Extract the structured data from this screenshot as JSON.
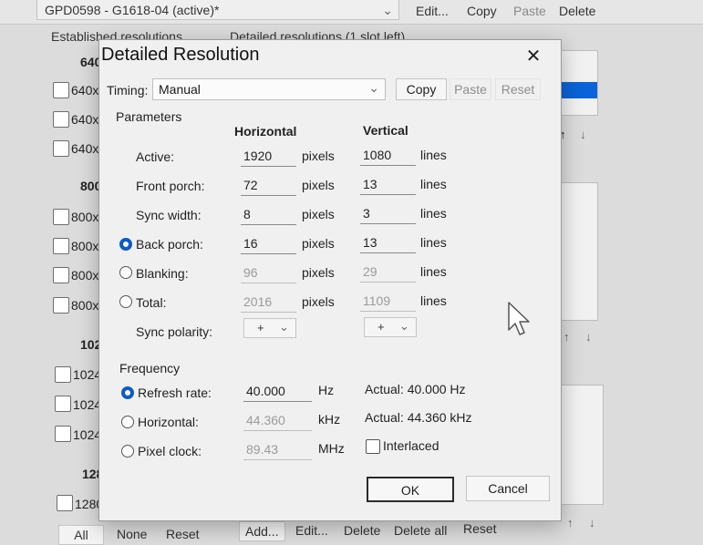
{
  "background": {
    "combo_value": "GPD0598 - G1618-04 (active)*",
    "top_buttons": {
      "edit": "Edit...",
      "copy": "Copy",
      "paste": "Paste",
      "delete": "Delete"
    },
    "tabs": {
      "established": "Established resolutions",
      "detailed": "Detailed resolutions (1 slot left)"
    },
    "groups": [
      {
        "header": "640",
        "rows": [
          "640x",
          "640x",
          "640x"
        ]
      },
      {
        "header": "800",
        "rows": [
          "800x",
          "800x",
          "800x",
          "800x"
        ]
      },
      {
        "header": "102",
        "rows": [
          "1024",
          "1024",
          "1024"
        ]
      },
      {
        "header": "128",
        "rows": [
          "1280"
        ]
      }
    ],
    "bottom_left": {
      "all": "All",
      "none": "None",
      "reset": "Reset"
    },
    "bottom_right": {
      "add": "Add...",
      "edit": "Edit...",
      "delete": "Delete",
      "delete_all": "Delete all",
      "reset": "Reset"
    },
    "arrows": {
      "up": "↑",
      "down": "↓"
    }
  },
  "dialog": {
    "title": "Detailed Resolution",
    "close": "✕",
    "timing_label": "Timing:",
    "timing_value": "Manual",
    "timing_buttons": {
      "copy": "Copy",
      "paste": "Paste",
      "reset": "Reset"
    },
    "parameters_label": "Parameters",
    "col_horizontal": "Horizontal",
    "col_vertical": "Vertical",
    "rows": [
      {
        "label": "Active:",
        "h": "1920",
        "h_unit": "pixels",
        "v": "1080",
        "v_unit": "lines"
      },
      {
        "label": "Front porch:",
        "h": "72",
        "h_unit": "pixels",
        "v": "13",
        "v_unit": "lines"
      },
      {
        "label": "Sync width:",
        "h": "8",
        "h_unit": "pixels",
        "v": "3",
        "v_unit": "lines"
      },
      {
        "label": "Back porch:",
        "h": "16",
        "h_unit": "pixels",
        "v": "13",
        "v_unit": "lines"
      },
      {
        "label": "Blanking:",
        "h": "96",
        "h_unit": "pixels",
        "v": "29",
        "v_unit": "lines"
      },
      {
        "label": "Total:",
        "h": "2016",
        "h_unit": "pixels",
        "v": "1109",
        "v_unit": "lines"
      }
    ],
    "sync_polarity_label": "Sync polarity:",
    "sync_h": "+",
    "sync_v": "+",
    "frequency_label": "Frequency",
    "freq": [
      {
        "label": "Refresh rate:",
        "value": "40.000",
        "unit": "Hz",
        "actual": "Actual: 40.000 Hz"
      },
      {
        "label": "Horizontal:",
        "value": "44.360",
        "unit": "kHz",
        "actual": "Actual: 44.360 kHz"
      },
      {
        "label": "Pixel clock:",
        "value": "89.43",
        "unit": "MHz"
      }
    ],
    "interlaced_label": "Interlaced",
    "ok": "OK",
    "cancel": "Cancel"
  }
}
